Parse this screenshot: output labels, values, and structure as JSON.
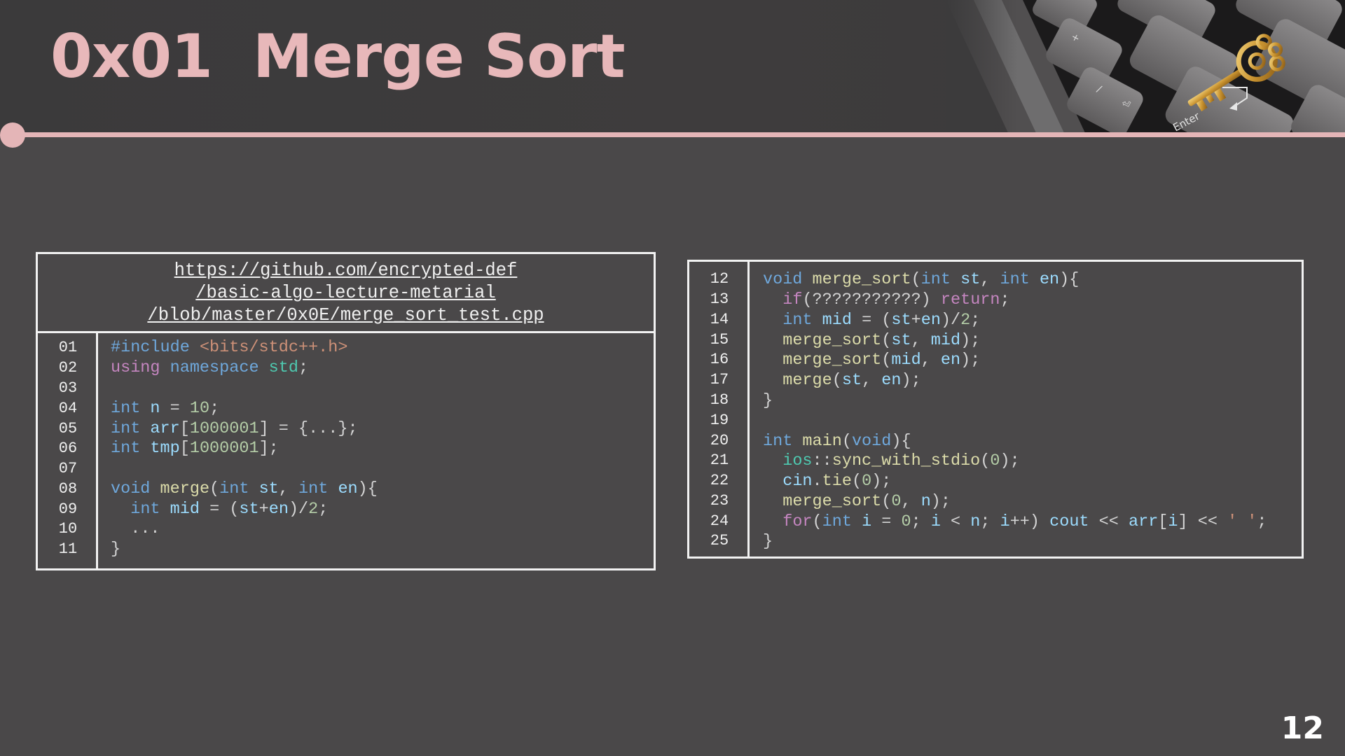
{
  "slide": {
    "title": "0x01  Merge Sort",
    "page_number": "12"
  },
  "colors": {
    "accent_pink": "#e4b5b7",
    "background": "#4a4849",
    "header_background": "#3b3a3b"
  },
  "images": {
    "header_photo": "keyboard-with-golden-key-photo"
  },
  "left_panel": {
    "url_lines": [
      "https://github.com/encrypted-def",
      "/basic-algo-lecture-metarial",
      "/blob/master/0x0E/merge_sort_test.cpp"
    ],
    "line_numbers": [
      "01",
      "02",
      "03",
      "04",
      "05",
      "06",
      "07",
      "08",
      "09",
      "10",
      "11"
    ]
  },
  "right_panel": {
    "line_numbers": [
      "12",
      "13",
      "14",
      "15",
      "16",
      "17",
      "18",
      "19",
      "20",
      "21",
      "22",
      "23",
      "24",
      "25"
    ]
  }
}
